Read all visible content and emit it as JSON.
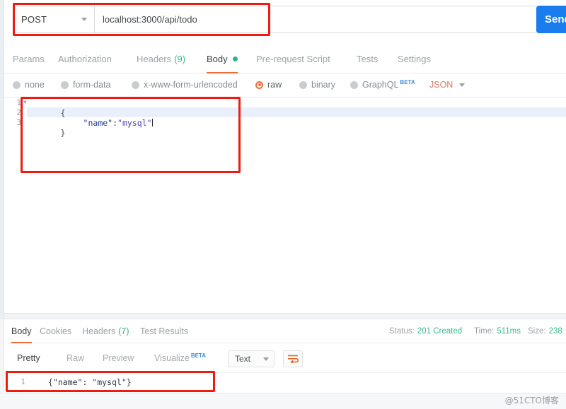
{
  "request": {
    "method": "POST",
    "url": "localhost:3000/api/todo",
    "send_label": "Send",
    "tabs": [
      {
        "label": "Params",
        "active": false,
        "count": null,
        "dot": false
      },
      {
        "label": "Authorization",
        "active": false,
        "count": null,
        "dot": false
      },
      {
        "label": "Headers",
        "active": false,
        "count": "(9)",
        "dot": false
      },
      {
        "label": "Body",
        "active": true,
        "count": null,
        "dot": true
      },
      {
        "label": "Pre-request Script",
        "active": false,
        "count": null,
        "dot": false
      },
      {
        "label": "Tests",
        "active": false,
        "count": null,
        "dot": false
      },
      {
        "label": "Settings",
        "active": false,
        "count": null,
        "dot": false
      }
    ],
    "body_types": [
      {
        "label": "none",
        "selected": false,
        "beta": null
      },
      {
        "label": "form-data",
        "selected": false,
        "beta": null
      },
      {
        "label": "x-www-form-urlencoded",
        "selected": false,
        "beta": null
      },
      {
        "label": "raw",
        "selected": true,
        "beta": null
      },
      {
        "label": "binary",
        "selected": false,
        "beta": null
      },
      {
        "label": "GraphQL",
        "selected": false,
        "beta": "BETA"
      }
    ],
    "format_select": "JSON",
    "editor": {
      "lines": [
        {
          "number": "1",
          "foldable": true,
          "highlighted": false,
          "text": "{"
        },
        {
          "number": "2",
          "foldable": false,
          "highlighted": true,
          "text": "    \"name\":\"mysql\""
        },
        {
          "number": "3",
          "foldable": false,
          "highlighted": false,
          "text": "}"
        }
      ],
      "line1_text": "{",
      "line2_key": "\"name\"",
      "line2_colon": ":",
      "line2_value": "\"mysql\"",
      "line3_text": "}"
    }
  },
  "response": {
    "tabs": [
      {
        "label": "Body",
        "active": true,
        "count": null
      },
      {
        "label": "Cookies",
        "active": false,
        "count": null
      },
      {
        "label": "Headers",
        "active": false,
        "count": "(7)"
      },
      {
        "label": "Test Results",
        "active": false,
        "count": null
      }
    ],
    "meta": {
      "status_label": "Status:",
      "status_value": "201 Created",
      "time_label": "Time:",
      "time_value": "511ms",
      "size_label": "Size:",
      "size_value": "238"
    },
    "view_tabs": [
      {
        "label": "Pretty",
        "active": true,
        "beta": null
      },
      {
        "label": "Raw",
        "active": false,
        "beta": null
      },
      {
        "label": "Preview",
        "active": false,
        "beta": null
      },
      {
        "label": "Visualize",
        "active": false,
        "beta": "BETA"
      }
    ],
    "format_select": "Text",
    "body": {
      "line_number": "1",
      "text": "{\"name\": \"mysql\"}"
    }
  },
  "watermark": "@51CTO博客",
  "colors": {
    "accent_orange": "#f06c36",
    "send_blue": "#1a7ced",
    "status_green": "#3ab98a",
    "annotation_red": "#ee1b11",
    "json_orange": "#d97b5e"
  }
}
